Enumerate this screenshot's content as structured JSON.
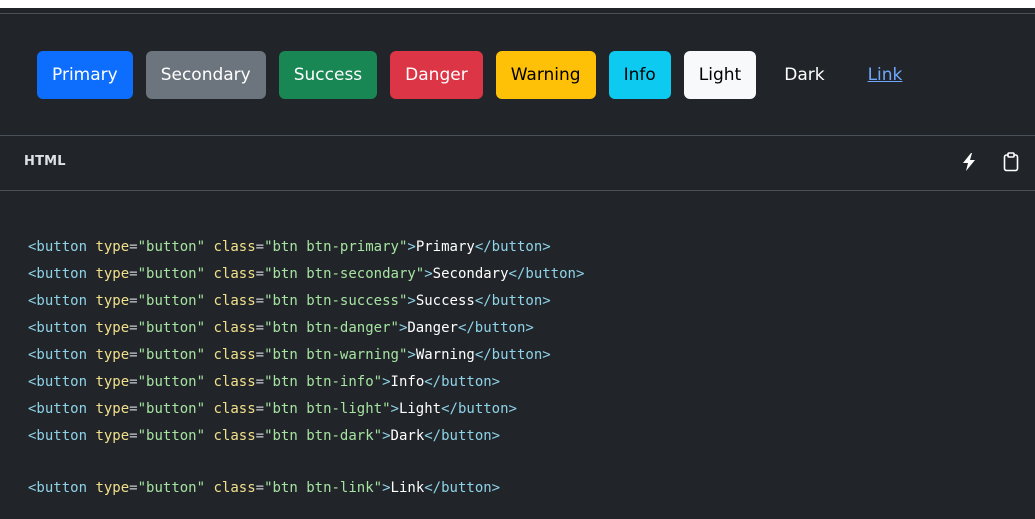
{
  "preview": {
    "buttons": [
      {
        "label": "Primary",
        "variant": "primary",
        "bg": "#0d6efd",
        "fg": "#ffffff"
      },
      {
        "label": "Secondary",
        "variant": "secondary",
        "bg": "#6c757d",
        "fg": "#ffffff"
      },
      {
        "label": "Success",
        "variant": "success",
        "bg": "#198754",
        "fg": "#ffffff"
      },
      {
        "label": "Danger",
        "variant": "danger",
        "bg": "#dc3545",
        "fg": "#ffffff"
      },
      {
        "label": "Warning",
        "variant": "warning",
        "bg": "#ffc107",
        "fg": "#000000"
      },
      {
        "label": "Info",
        "variant": "info",
        "bg": "#0dcaf0",
        "fg": "#000000"
      },
      {
        "label": "Light",
        "variant": "light",
        "bg": "#f8f9fa",
        "fg": "#000000"
      },
      {
        "label": "Dark",
        "variant": "dark",
        "bg": "#212529",
        "fg": "#ffffff"
      },
      {
        "label": "Link",
        "variant": "link",
        "bg": "transparent",
        "fg": "#6ea8fe"
      }
    ]
  },
  "code_header": {
    "language": "HTML",
    "icons": [
      "bolt-icon",
      "clipboard-icon"
    ]
  },
  "code": {
    "lines": [
      {
        "type": "button",
        "class": "btn btn-primary",
        "text": "Primary"
      },
      {
        "type": "button",
        "class": "btn btn-secondary",
        "text": "Secondary"
      },
      {
        "type": "button",
        "class": "btn btn-success",
        "text": "Success"
      },
      {
        "type": "button",
        "class": "btn btn-danger",
        "text": "Danger"
      },
      {
        "type": "button",
        "class": "btn btn-warning",
        "text": "Warning"
      },
      {
        "type": "button",
        "class": "btn btn-info",
        "text": "Info"
      },
      {
        "type": "button",
        "class": "btn btn-light",
        "text": "Light"
      },
      {
        "type": "button",
        "class": "btn btn-dark",
        "text": "Dark"
      },
      {
        "type": "button",
        "class": "btn btn-link",
        "text": "Link"
      }
    ]
  },
  "colors": {
    "background": "#212529",
    "border": "#495057",
    "tag": "#8fd3e8",
    "attribute": "#f1e08b",
    "string": "#a6e3a1",
    "text": "#ffffff"
  }
}
